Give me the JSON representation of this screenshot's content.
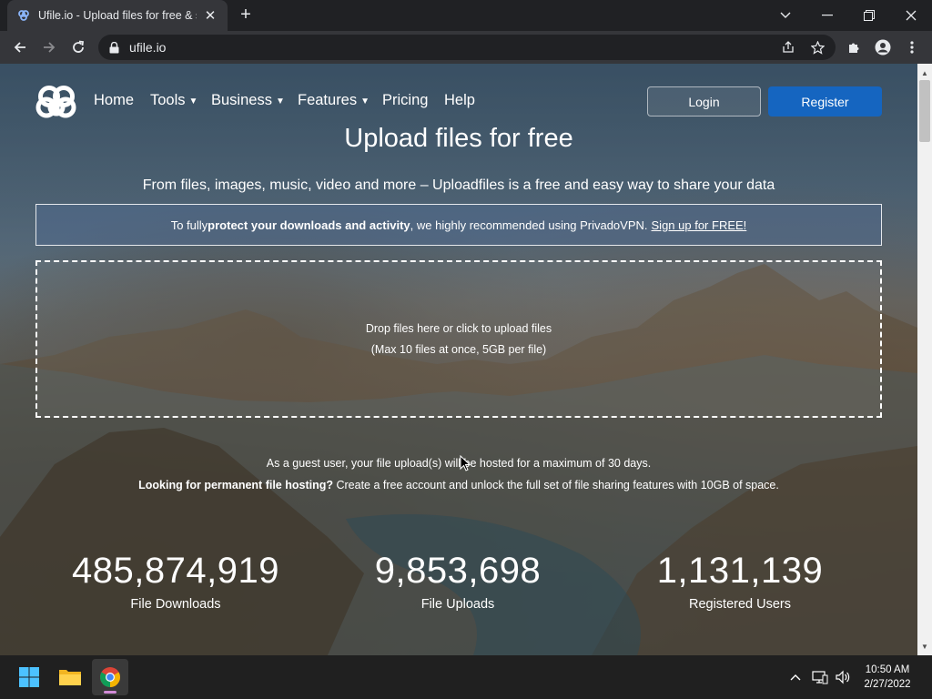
{
  "browser": {
    "tab_title": "Ufile.io - Upload files for free & s",
    "url": "ufile.io"
  },
  "nav": {
    "items": [
      {
        "label": "Home",
        "has_caret": false
      },
      {
        "label": "Tools",
        "has_caret": true
      },
      {
        "label": "Business",
        "has_caret": true
      },
      {
        "label": "Features",
        "has_caret": true
      },
      {
        "label": "Pricing",
        "has_caret": false
      },
      {
        "label": "Help",
        "has_caret": false
      }
    ],
    "login_label": "Login",
    "register_label": "Register"
  },
  "hero": {
    "headline": "Upload files for free",
    "subhead": "From files, images, music, video and more – Uploadfiles is a free and easy way to share your data"
  },
  "vpn_banner": {
    "prefix": "To fully ",
    "bold": "protect your downloads and activity",
    "middle": ", we highly recommended using PrivadoVPN.",
    "link": "Sign up for FREE!"
  },
  "dropzone": {
    "line1": "Drop files here or click to upload files",
    "line2": "(Max 10 files at once, 5GB per file)"
  },
  "notes": {
    "guest": "As a guest user, your file upload(s) will be hosted for a maximum of 30 days.",
    "perm_bold": "Looking for permanent file hosting?",
    "perm_rest": " Create a free account and unlock the full set of file sharing features with 10GB of space."
  },
  "stats": [
    {
      "value": "485,874,919",
      "label": "File Downloads"
    },
    {
      "value": "9,853,698",
      "label": "File Uploads"
    },
    {
      "value": "1,131,139",
      "label": "Registered Users"
    }
  ],
  "taskbar": {
    "time": "10:50 AM",
    "date": "2/27/2022"
  },
  "colors": {
    "register_bg": "#1565c0",
    "chrome_bg": "#202124",
    "toolbar_bg": "#35363a"
  }
}
